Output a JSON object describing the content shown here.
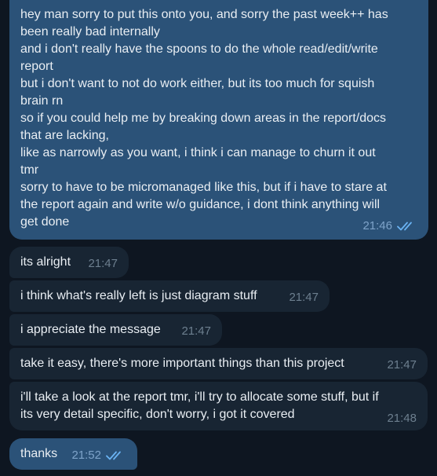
{
  "messages": [
    {
      "direction": "outgoing",
      "lines": [
        "hey man sorry to put this onto you, and sorry the past week++ has",
        "been really bad internally",
        "and i don't really have the spoons to do the whole read/edit/write",
        "report",
        "but i don't want to not do work either, but its too much for squish",
        "brain rn",
        "so if you could help me by breaking down areas in the report/docs",
        "that are lacking,",
        "like as narrowly as you want, i think i can manage to churn it out",
        "tmr",
        "sorry to have to be micromanaged like this, but if i have to stare at",
        "the report again and write w/o guidance, i dont think anything will",
        "get done"
      ],
      "time": "21:46",
      "read": true
    },
    {
      "direction": "incoming",
      "text": "its alright",
      "time": "21:47"
    },
    {
      "direction": "incoming",
      "text": "i think what's really left is just diagram stuff",
      "time": "21:47"
    },
    {
      "direction": "incoming",
      "text": "i appreciate the message",
      "time": "21:47"
    },
    {
      "direction": "incoming",
      "text": "take it easy, there's more important things than this project",
      "time": "21:47"
    },
    {
      "direction": "incoming",
      "lines": [
        "i'll take a look at the report tmr, i'll try to allocate some stuff, but if",
        "its very detail specific, don't worry, i got it covered"
      ],
      "time": "21:48"
    },
    {
      "direction": "outgoing",
      "text": "thanks",
      "time": "21:52",
      "read": true
    }
  ],
  "colors": {
    "background": "#0e1621",
    "outgoing_bubble": "#2b5278",
    "incoming_bubble": "#182533",
    "text": "#e9eef3",
    "read_checks": "#6ab3f3"
  },
  "icons": {
    "read_receipt": "double-check-icon"
  }
}
